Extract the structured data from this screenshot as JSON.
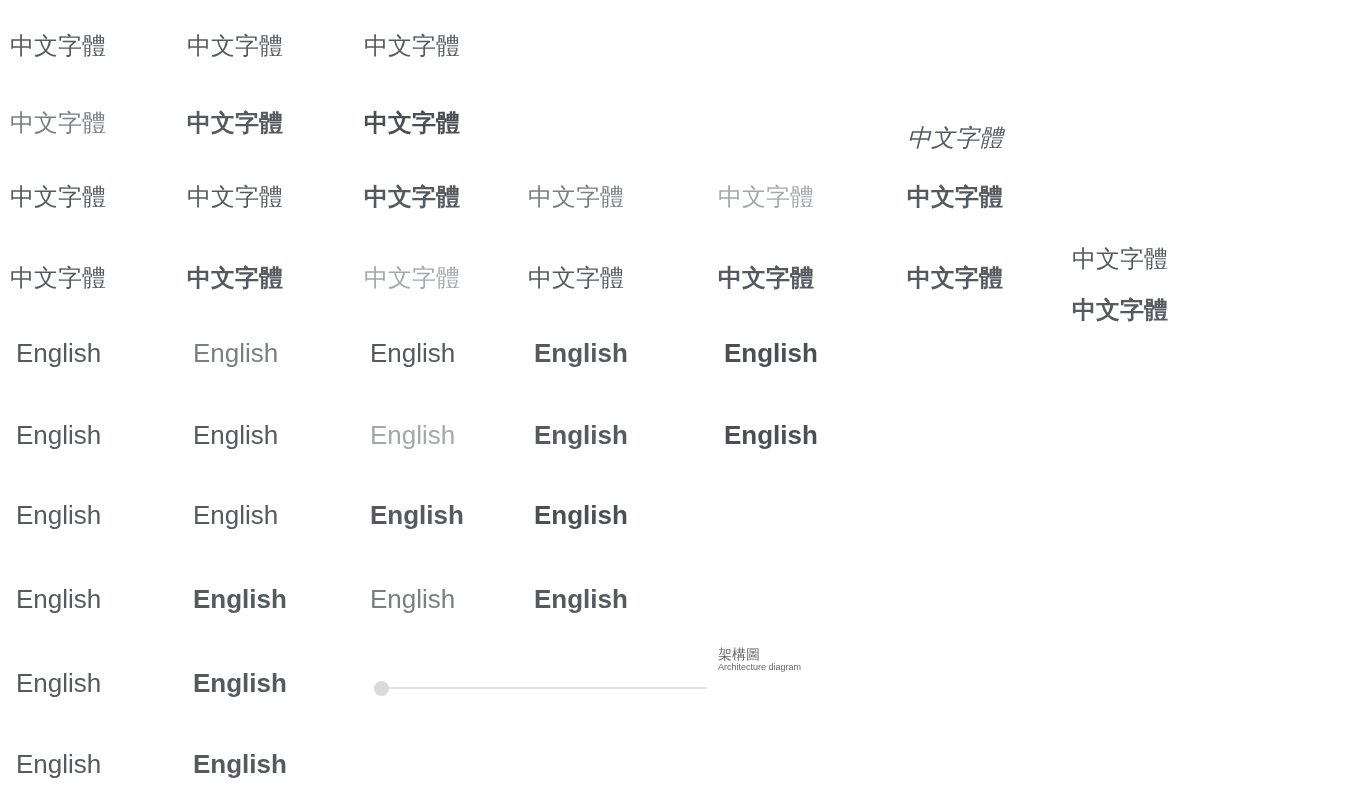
{
  "chinese_rows": [
    {
      "samples": [
        {
          "text": "中文字體",
          "kind": "regular"
        },
        {
          "text": "中文字體",
          "kind": "regular"
        },
        {
          "text": "中文字體",
          "kind": "regular"
        }
      ]
    },
    {
      "samples": [
        {
          "text": "中文字體",
          "kind": "light"
        },
        {
          "text": "中文字體",
          "kind": "bold"
        },
        {
          "text": "中文字體",
          "kind": "black"
        }
      ],
      "script_sample": {
        "text": "中文字體",
        "kind": "handwritten"
      }
    },
    {
      "samples": [
        {
          "text": "中文字體",
          "kind": "regular"
        },
        {
          "text": "中文字體",
          "kind": "regular"
        },
        {
          "text": "中文字體",
          "kind": "bold"
        },
        {
          "text": "中文字體",
          "kind": "light"
        },
        {
          "text": "中文字體",
          "kind": "thin"
        },
        {
          "text": "中文字體",
          "kind": "bold"
        }
      ]
    },
    {
      "samples": [
        {
          "text": "中文字體",
          "kind": "regular"
        },
        {
          "text": "中文字體",
          "kind": "bold"
        },
        {
          "text": "中文字體",
          "kind": "thin"
        },
        {
          "text": "中文字體",
          "kind": "regular"
        },
        {
          "text": "中文字體",
          "kind": "bold"
        },
        {
          "text": "中文字體",
          "kind": "bold"
        }
      ],
      "side_samples": [
        {
          "text": "中文字體",
          "kind": "regular"
        },
        {
          "text": "中文字體",
          "kind": "bold"
        }
      ]
    }
  ],
  "english_rows": [
    {
      "samples": [
        {
          "text": "English",
          "kind": "regular"
        },
        {
          "text": "English",
          "kind": "light"
        },
        {
          "text": "English",
          "kind": "medium"
        },
        {
          "text": "English",
          "kind": "bold"
        },
        {
          "text": "English",
          "kind": "black"
        }
      ]
    },
    {
      "samples": [
        {
          "text": "English",
          "kind": "regular"
        },
        {
          "text": "English",
          "kind": "medium"
        },
        {
          "text": "English",
          "kind": "thin"
        },
        {
          "text": "English",
          "kind": "bold"
        },
        {
          "text": "English",
          "kind": "black"
        }
      ]
    },
    {
      "samples": [
        {
          "text": "English",
          "kind": "regular"
        },
        {
          "text": "English",
          "kind": "regular"
        },
        {
          "text": "English",
          "kind": "bold"
        },
        {
          "text": "English",
          "kind": "black"
        }
      ]
    },
    {
      "samples": [
        {
          "text": "English",
          "kind": "regular"
        },
        {
          "text": "English",
          "kind": "bold"
        },
        {
          "text": "English",
          "kind": "light"
        },
        {
          "text": "English",
          "kind": "bold"
        }
      ]
    },
    {
      "samples": [
        {
          "text": "English",
          "kind": "regular"
        },
        {
          "text": "English",
          "kind": "bold"
        }
      ],
      "slider": {
        "level": 0
      },
      "caption": {
        "title": "架構圖",
        "subtitle": "Architecture diagram"
      }
    },
    {
      "samples": [
        {
          "text": "English",
          "kind": "regular"
        },
        {
          "text": "English",
          "kind": "bold"
        }
      ]
    }
  ]
}
